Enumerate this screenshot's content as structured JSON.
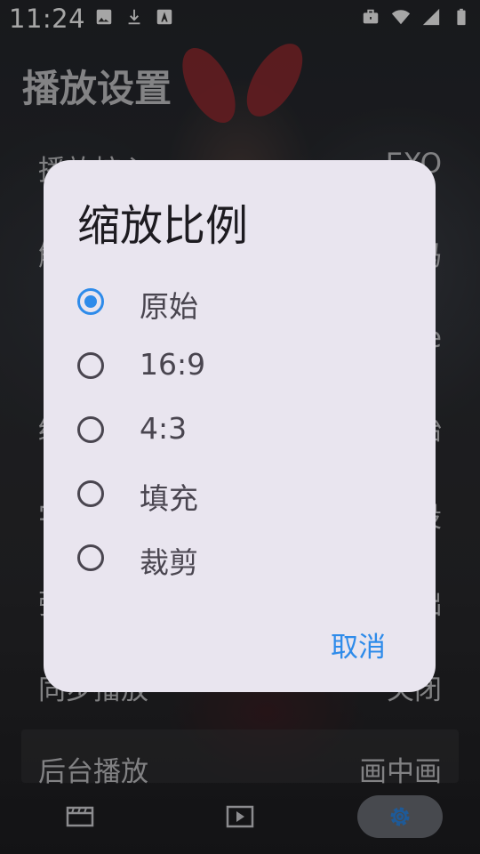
{
  "status_bar": {
    "time": "11:24",
    "left_icons": [
      "image-icon",
      "download-icon",
      "font-icon"
    ],
    "right_icons": [
      "briefcase-icon",
      "wifi-icon",
      "signal-icon",
      "battery-icon"
    ]
  },
  "settings": {
    "title": "播放设置",
    "rows": [
      {
        "label": "播放核心",
        "value": "EXO"
      },
      {
        "label": "解",
        "value": "码"
      },
      {
        "label": "",
        "value": "e"
      },
      {
        "label": "缓",
        "value": "始"
      },
      {
        "label": "字",
        "value": "设"
      },
      {
        "label": "弹",
        "value": "础"
      },
      {
        "label": "同步播放",
        "value": "关闭"
      },
      {
        "label": "后台播放",
        "value": "画中画"
      }
    ]
  },
  "dialog": {
    "title": "缩放比例",
    "options": [
      {
        "label": "原始",
        "selected": true
      },
      {
        "label": "16:9",
        "selected": false
      },
      {
        "label": "4:3",
        "selected": false
      },
      {
        "label": "填充",
        "selected": false
      },
      {
        "label": "裁剪",
        "selected": false
      }
    ],
    "cancel_label": "取消"
  },
  "bottom_nav": {
    "items": [
      {
        "icon": "film-icon",
        "active": false
      },
      {
        "icon": "play-icon",
        "active": false
      },
      {
        "icon": "gear-icon",
        "active": true
      }
    ]
  },
  "colors": {
    "accent": "#2e8bea",
    "dialog_bg": "#e9e5ef",
    "nav_active": "#6e7078"
  }
}
